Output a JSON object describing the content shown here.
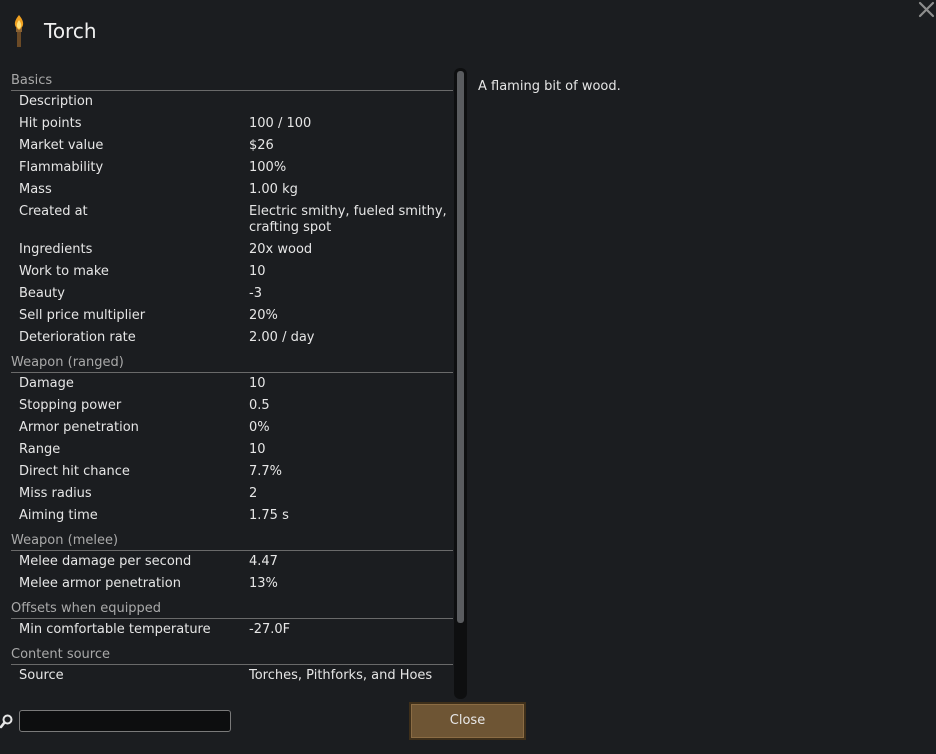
{
  "window": {
    "title": "Torch"
  },
  "description": "A flaming bit of wood.",
  "sections": [
    {
      "header": "Basics",
      "rows": [
        {
          "label": "Description",
          "value": ""
        },
        {
          "label": "Hit points",
          "value": "100 / 100"
        },
        {
          "label": "Market value",
          "value": "$26"
        },
        {
          "label": "Flammability",
          "value": "100%"
        },
        {
          "label": "Mass",
          "value": "1.00 kg"
        },
        {
          "label": "Created at",
          "value": "Electric smithy, fueled smithy, crafting spot"
        },
        {
          "label": "Ingredients",
          "value": "20x wood"
        },
        {
          "label": "Work to make",
          "value": "10"
        },
        {
          "label": "Beauty",
          "value": "-3"
        },
        {
          "label": "Sell price multiplier",
          "value": "20%"
        },
        {
          "label": "Deterioration rate",
          "value": "2.00 / day"
        }
      ]
    },
    {
      "header": "Weapon (ranged)",
      "rows": [
        {
          "label": "Damage",
          "value": "10"
        },
        {
          "label": "Stopping power",
          "value": "0.5"
        },
        {
          "label": "Armor penetration",
          "value": "0%"
        },
        {
          "label": "Range",
          "value": "10"
        },
        {
          "label": "Direct hit chance",
          "value": "7.7%"
        },
        {
          "label": "Miss radius",
          "value": "2"
        },
        {
          "label": "Aiming time",
          "value": "1.75 s"
        }
      ]
    },
    {
      "header": "Weapon (melee)",
      "rows": [
        {
          "label": "Melee damage per second",
          "value": "4.47"
        },
        {
          "label": "Melee armor penetration",
          "value": "13%"
        }
      ]
    },
    {
      "header": "Offsets when equipped",
      "rows": [
        {
          "label": "Min comfortable temperature",
          "value": "-27.0F"
        }
      ]
    },
    {
      "header": "Content source",
      "rows": [
        {
          "label": "Source",
          "value": "Torches, Pithforks, and Hoes"
        }
      ]
    }
  ],
  "search": {
    "value": "",
    "placeholder": ""
  },
  "buttons": {
    "close_label": "Close"
  },
  "icons": {
    "title": "torch-icon",
    "close": "close-icon",
    "search": "search-icon"
  },
  "colors": {
    "background": "#1b1d20",
    "button": "#6e5534",
    "divider": "#6a6a6a",
    "header_text": "#a9a9a9"
  }
}
